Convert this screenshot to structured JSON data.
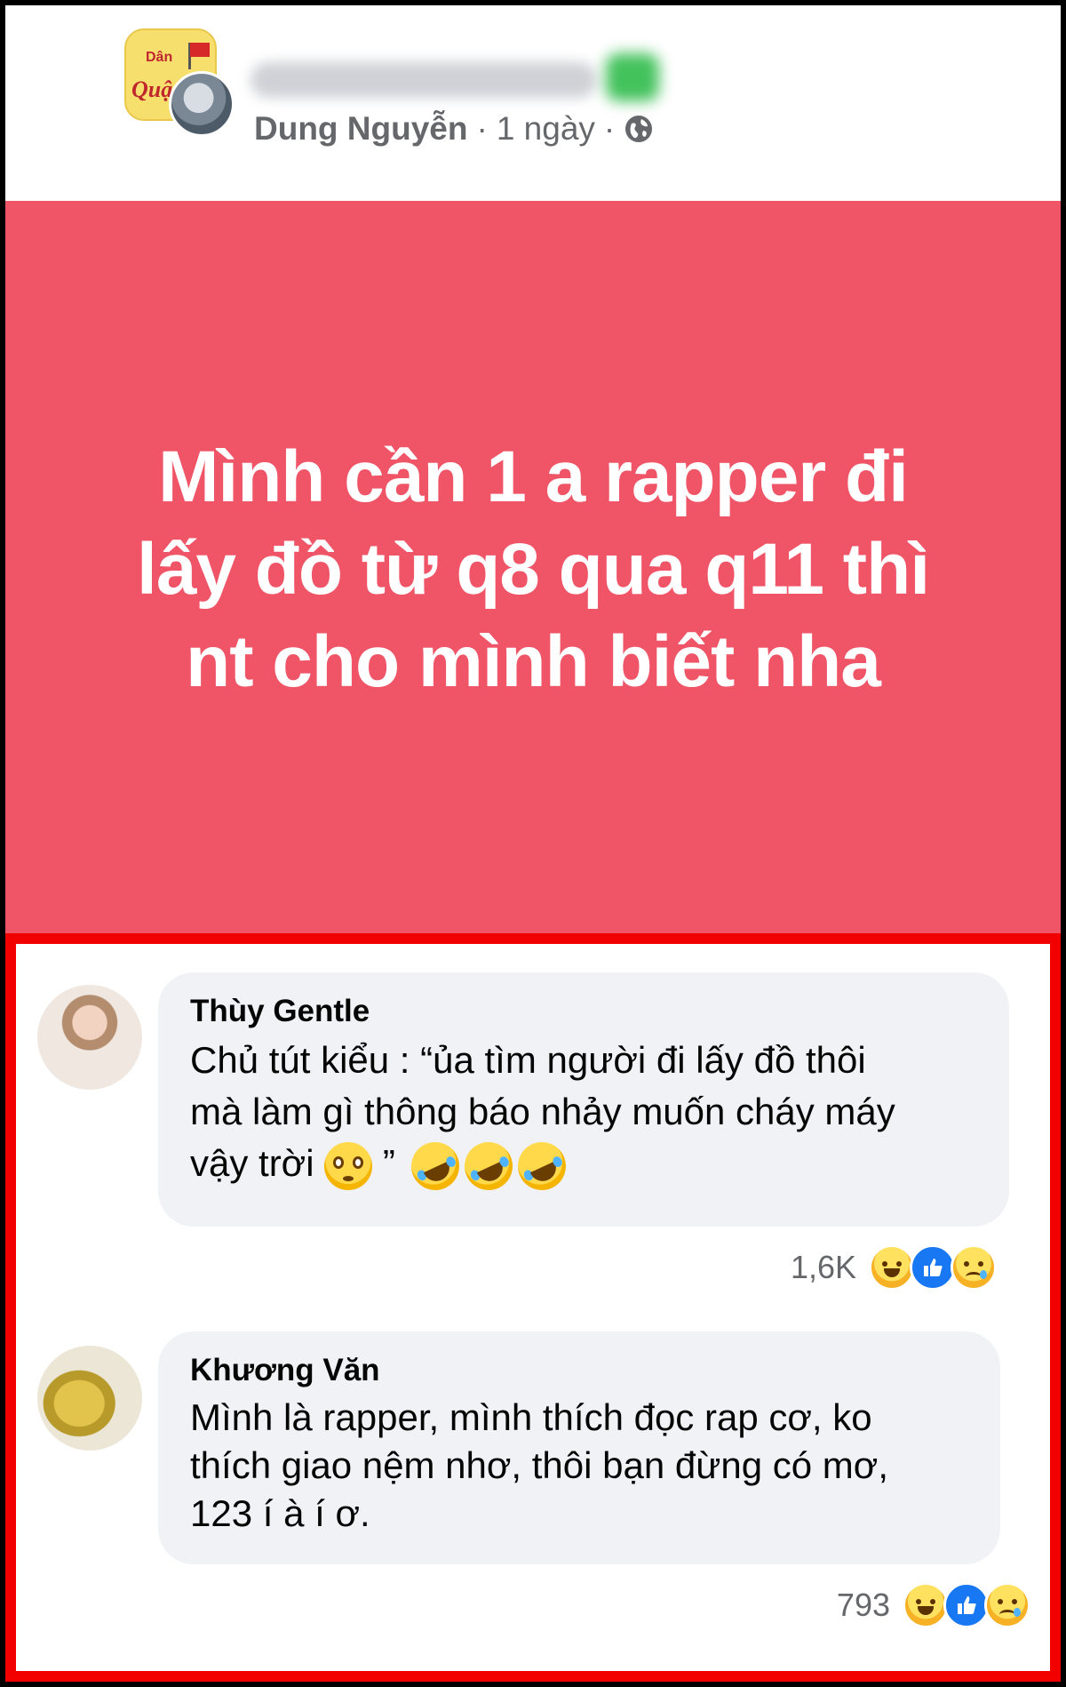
{
  "post": {
    "author": "Dung Nguyễn",
    "separator": "·",
    "time": "1 ngày",
    "group_logo": {
      "line1": "Dân",
      "line2": "Quậ"
    },
    "body": "Mình cần 1 a rapper đi\nlấy đồ từ q8 qua q11 thì\nnt cho mình biết nha",
    "background_color": "#ef5467"
  },
  "comments": [
    {
      "author": "Thùy Gentle",
      "text_line1": "Chủ tút kiểu : “ủa tìm người đi lấy đồ thôi",
      "text_line2": "mà làm gì thông báo nhảy muốn cháy máy",
      "text_line3": "vậy trời",
      "text_tail": "”",
      "emojis": [
        "flushed-face",
        "rolling-laughing-face",
        "rolling-laughing-face",
        "rolling-laughing-face"
      ],
      "reaction_count": "1,6K",
      "reactions": [
        "haha",
        "like",
        "sad"
      ]
    },
    {
      "author": "Khương Văn",
      "text_line1": "Mình là rapper, mình thích đọc rap cơ, ko",
      "text_line2": "thích giao nệm nhơ, thôi bạn đừng có mơ,",
      "text_line3": "123 í à í ơ.",
      "reaction_count": "793",
      "reactions": [
        "haha",
        "like",
        "sad"
      ]
    }
  ],
  "colors": {
    "highlight_border": "#f20000",
    "bubble": "#f0f2f5",
    "like_blue": "#1877f2"
  }
}
